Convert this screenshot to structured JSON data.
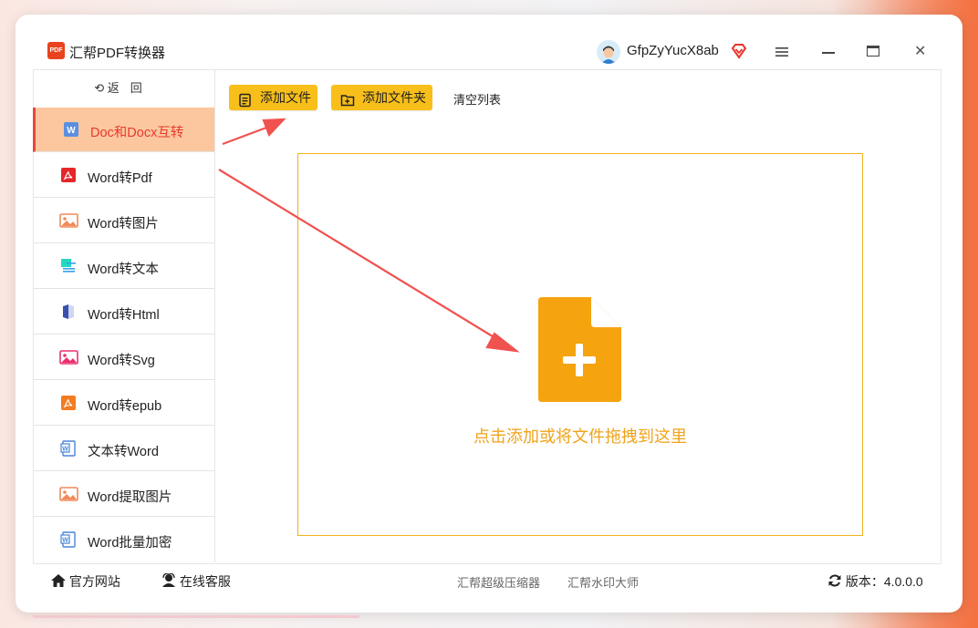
{
  "app": {
    "title": "汇帮PDF转换器",
    "logo_text": "PDF"
  },
  "user": {
    "name": "GfpZyYucX8ab"
  },
  "sidebar": {
    "back_label": "返回",
    "items": [
      {
        "label": "Doc和Docx互转",
        "icon": "word-doc-icon",
        "active": true
      },
      {
        "label": "Word转Pdf",
        "icon": "pdf-icon"
      },
      {
        "label": "Word转图片",
        "icon": "image-icon"
      },
      {
        "label": "Word转文本",
        "icon": "text-doc-icon"
      },
      {
        "label": "Word转Html",
        "icon": "html-book-icon"
      },
      {
        "label": "Word转Svg",
        "icon": "svg-image-icon"
      },
      {
        "label": "Word转epub",
        "icon": "epub-icon"
      },
      {
        "label": "文本转Word",
        "icon": "word-file-icon"
      },
      {
        "label": "Word提取图片",
        "icon": "image-extract-icon"
      },
      {
        "label": "Word批量加密",
        "icon": "word-lock-icon"
      }
    ]
  },
  "toolbar": {
    "add_file": "添加文件",
    "add_folder": "添加文件夹",
    "clear_list": "清空列表"
  },
  "dropzone": {
    "hint": "点击添加或将文件拖拽到这里"
  },
  "footer": {
    "website": "官方网站",
    "support": "在线客服",
    "link1": "汇帮超级压缩器",
    "link2": "汇帮水印大师",
    "version_label": "版本：",
    "version": "4.0.0.0"
  },
  "colors": {
    "accent": "#f8bf1a",
    "active_bg": "#fcc79f",
    "active_text": "#e8382c",
    "drop_icon": "#f5a30f",
    "arrow": "#f0524f"
  }
}
